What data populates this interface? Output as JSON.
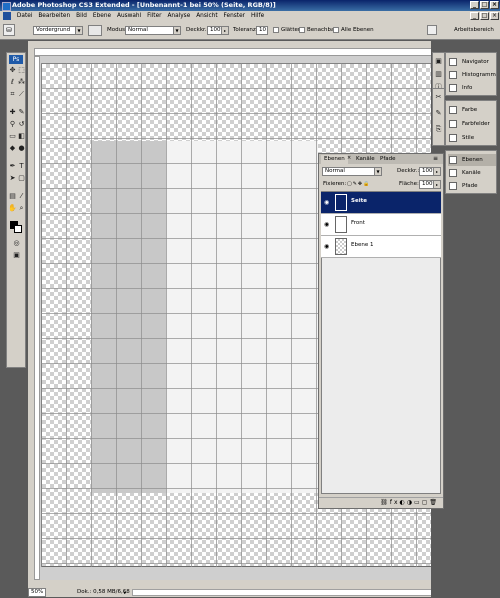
{
  "title": "Adobe Photoshop CS3 Extended - [Unbenannt-1 bei 50% (Seite, RGB/8)]",
  "menu": [
    "Datei",
    "Bearbeiten",
    "Bild",
    "Ebene",
    "Auswahl",
    "Filter",
    "Analyse",
    "Ansicht",
    "Fenster",
    "Hilfe"
  ],
  "options": {
    "tool_preset": "Vordergrund",
    "mode_label": "Modus:",
    "mode_value": "Normal",
    "opacity_label": "Deckkr.:",
    "opacity_value": "100%",
    "tolerance_label": "Toleranz:",
    "tolerance_value": "10",
    "smooth_label": "Glätten",
    "contiguous_label": "Benachbart",
    "all_layers_label": "Alle Ebenen",
    "workspace_label": "Arbeitsbereich"
  },
  "dock": {
    "group1": [
      "Navigator",
      "Histogramm",
      "Info"
    ],
    "group2": [
      "Farbe",
      "Farbfelder",
      "Stile"
    ],
    "group3": [
      "Ebenen",
      "Kanäle",
      "Pfade"
    ]
  },
  "layers_panel": {
    "tabs": [
      "Ebenen",
      "Kanäle",
      "Pfade"
    ],
    "blend_mode": "Normal",
    "opacity_label": "Deckkr.:",
    "opacity_value": "100%",
    "lock_label": "Fixieren:",
    "fill_label": "Fläche:",
    "fill_value": "100%",
    "layers": [
      "Seite",
      "Front",
      "Ebene 1"
    ]
  },
  "status": {
    "zoom": "50%",
    "doc": "Dok.: 0,58 MB/6,68 MB"
  },
  "colors": {
    "titlebar": "#0a246a",
    "selected_layer": "#0a246a",
    "chrome": "#d4d0c8"
  }
}
